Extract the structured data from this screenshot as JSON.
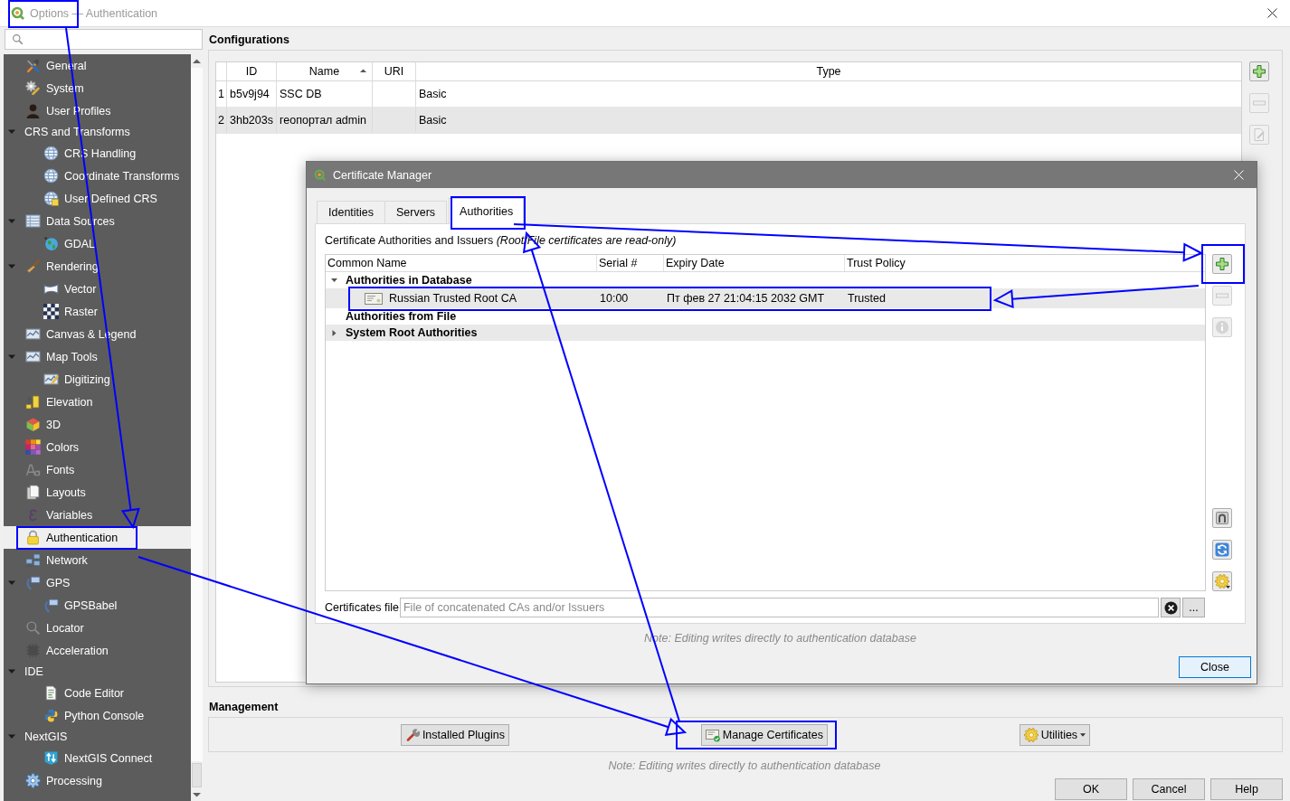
{
  "window": {
    "title": "Options — Authentication"
  },
  "sidebar": {
    "items": [
      {
        "label": "General",
        "selected": false
      },
      {
        "label": "System",
        "selected": false
      },
      {
        "label": "User Profiles",
        "selected": false
      },
      {
        "label": "CRS and Transforms",
        "selected": false,
        "expanded": true,
        "children": [
          {
            "label": "CRS Handling",
            "selected": false
          },
          {
            "label": "Coordinate Transforms",
            "selected": false
          },
          {
            "label": "User Defined CRS",
            "selected": false
          }
        ]
      },
      {
        "label": "Data Sources",
        "selected": false,
        "expanded": true,
        "children": [
          {
            "label": "GDAL",
            "selected": false
          }
        ]
      },
      {
        "label": "Rendering",
        "selected": false,
        "expanded": true,
        "children": [
          {
            "label": "Vector",
            "selected": false
          },
          {
            "label": "Raster",
            "selected": false
          }
        ]
      },
      {
        "label": "Canvas & Legend",
        "selected": false
      },
      {
        "label": "Map Tools",
        "selected": false,
        "expanded": true,
        "children": [
          {
            "label": "Digitizing",
            "selected": false
          }
        ]
      },
      {
        "label": "Elevation",
        "selected": false
      },
      {
        "label": "3D",
        "selected": false
      },
      {
        "label": "Colors",
        "selected": false
      },
      {
        "label": "Fonts",
        "selected": false
      },
      {
        "label": "Layouts",
        "selected": false
      },
      {
        "label": "Variables",
        "selected": false
      },
      {
        "label": "Authentication",
        "selected": true
      },
      {
        "label": "Network",
        "selected": false
      },
      {
        "label": "GPS",
        "selected": false,
        "expanded": true,
        "children": [
          {
            "label": "GPSBabel",
            "selected": false
          }
        ]
      },
      {
        "label": "Locator",
        "selected": false
      },
      {
        "label": "Acceleration",
        "selected": false
      },
      {
        "label": "IDE",
        "selected": false,
        "expanded": true,
        "children": [
          {
            "label": "Code Editor",
            "selected": false
          },
          {
            "label": "Python Console",
            "selected": false
          }
        ]
      },
      {
        "label": "NextGIS",
        "selected": false,
        "expanded": true,
        "children": [
          {
            "label": "NextGIS Connect",
            "selected": false
          }
        ]
      },
      {
        "label": "Processing",
        "selected": false
      }
    ]
  },
  "configurations": {
    "title": "Configurations",
    "columns": [
      {
        "label": "ID",
        "sorted": false
      },
      {
        "label": "Name",
        "sorted": true
      },
      {
        "label": "URI",
        "sorted": false
      },
      {
        "label": "Type",
        "sorted": false
      }
    ],
    "rows": [
      {
        "number": "1",
        "id": "b5v9j94",
        "name": "SSC DB",
        "type": "Basic"
      },
      {
        "number": "2",
        "id": "3hb203s",
        "name": "геопортал admin",
        "type": "Basic"
      }
    ],
    "tools": [
      {
        "kind": "add",
        "disabled": false
      },
      {
        "kind": "remove",
        "disabled": true
      },
      {
        "kind": "edit",
        "disabled": true
      }
    ]
  },
  "management": {
    "title": "Management",
    "buttons": [
      {
        "label": "Installed Plugins",
        "dropdown": false
      },
      {
        "label": "Manage Certificates",
        "dropdown": false
      },
      {
        "label": "Utilities",
        "dropdown": true
      }
    ],
    "note": "Note: Editing writes directly to authentication database"
  },
  "buttons": [
    "OK",
    "Cancel",
    "Help"
  ],
  "certificate_manager": {
    "title": "Certificate Manager",
    "tabs": [
      {
        "label": "Identities",
        "selected": false
      },
      {
        "label": "Servers",
        "selected": false
      },
      {
        "label": "Authorities",
        "selected": true
      }
    ],
    "caption": "Certificate Authorities and Issuers *(Root/File certificates are read-only)*",
    "columns": [
      "Common Name",
      "Serial #",
      "Expiry Date",
      "Trust Policy"
    ],
    "groups": [
      {
        "label": "Authorities in Database",
        "expanded": true,
        "children": [
          {
            "common_name": "Russian Trusted Root CA",
            "serial": "10:00",
            "expiry": "Пт фев 27 21:04:15 2032 GMT",
            "trust_policy": "Trusted"
          }
        ]
      },
      {
        "label": "Authorities from File"
      },
      {
        "label": "System Root Authorities",
        "expanded": false
      }
    ],
    "tools": [
      {
        "kind": "add",
        "disabled": false
      },
      {
        "kind": "remove",
        "disabled": true
      },
      {
        "kind": "info",
        "disabled": true
      },
      {
        "kind": "group",
        "disabled": false
      },
      {
        "kind": "refresh",
        "disabled": false
      },
      {
        "kind": "options",
        "disabled": false
      }
    ],
    "file_label": "Certificates file",
    "file_field": {
      "placeholder": "File of concatenated CAs and/or Issuers"
    },
    "browse_button": "...",
    "note": "Note: Editing writes directly to authentication database",
    "close_button": "Close"
  },
  "annotations": [
    {
      "kind": "frame"
    },
    {
      "kind": "arrow"
    },
    {
      "kind": "frame"
    },
    {
      "kind": "arrow"
    },
    {
      "kind": "frame"
    },
    {
      "kind": "arrow"
    },
    {
      "kind": "frame"
    },
    {
      "kind": "arrow"
    },
    {
      "kind": "frame"
    },
    {
      "kind": "arrow"
    },
    {
      "kind": "frame"
    }
  ]
}
